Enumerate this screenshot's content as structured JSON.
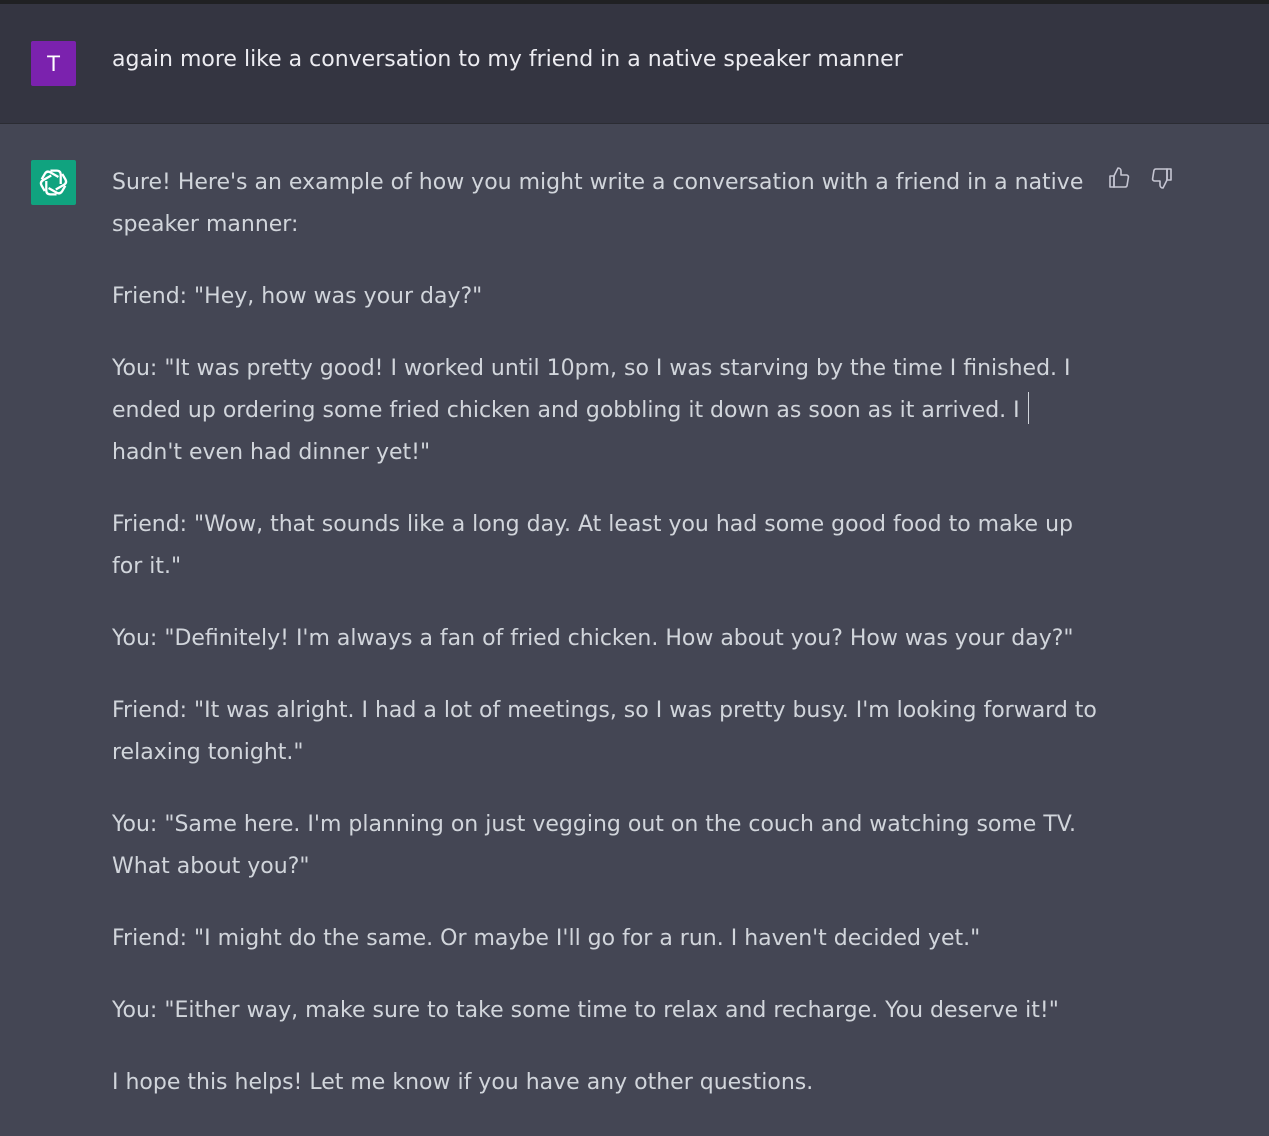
{
  "user_message": {
    "avatar_letter": "T",
    "avatar_color": "#7b22ae",
    "text": "again more like a conversation to my friend in a native speaker manner"
  },
  "assistant_message": {
    "avatar_icon": "openai-logo-icon",
    "avatar_color": "#10a37f",
    "paragraphs": [
      "Sure! Here's an example of how you might write a conversation with a friend in a native speaker manner:",
      "Friend: \"Hey, how was your day?\"",
      "You: \"It was pretty good! I worked until 10pm, so I was starving by the time I finished. I ended up ordering some fried chicken and gobbling it down as soon as it arrived. I hadn't even had dinner yet!\"",
      "Friend: \"Wow, that sounds like a long day. At least you had some good food to make up for it.\"",
      "You: \"Definitely! I'm always a fan of fried chicken. How about you? How was your day?\"",
      "Friend: \"It was alright. I had a lot of meetings, so I was pretty busy. I'm looking forward to relaxing tonight.\"",
      "You: \"Same here. I'm planning on just vegging out on the couch and watching some TV. What about you?\"",
      "Friend: \"I might do the same. Or maybe I'll go for a run. I haven't decided yet.\"",
      "You: \"Either way, make sure to take some time to relax and recharge. You deserve it!\"",
      "I hope this helps! Let me know if you have any other questions."
    ]
  },
  "feedback": {
    "thumbs_up_icon": "thumbs-up-icon",
    "thumbs_down_icon": "thumbs-down-icon"
  },
  "colors": {
    "user_row_bg": "#343541",
    "assistant_row_bg": "#444654",
    "text": "#d1d5db"
  }
}
